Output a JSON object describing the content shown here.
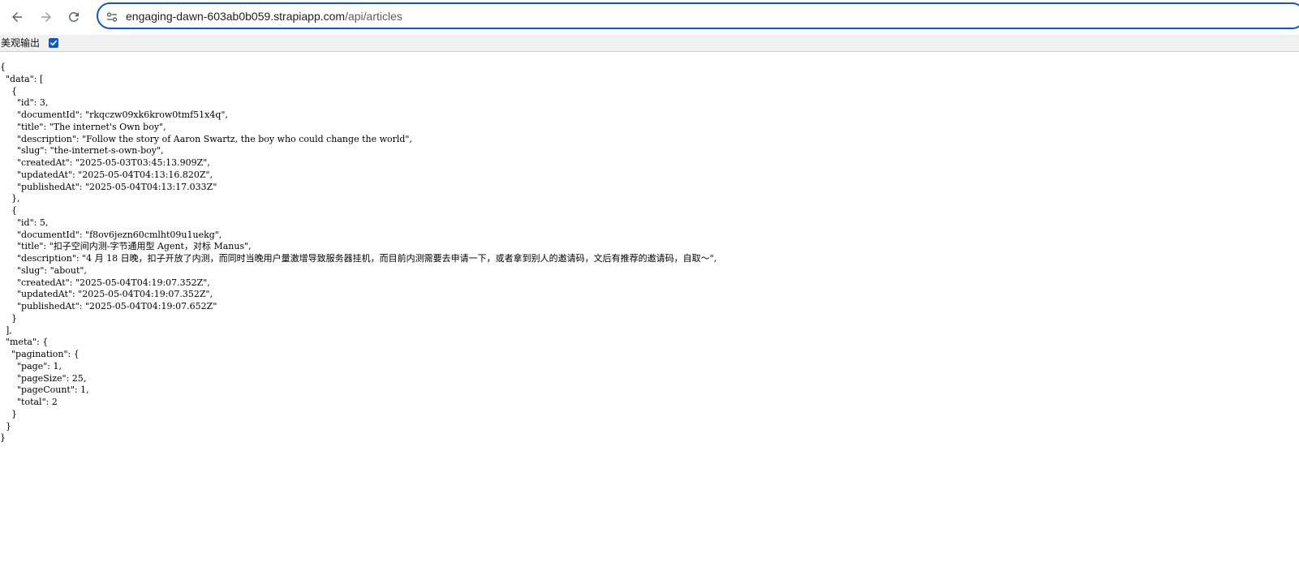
{
  "browser": {
    "url_host": "engaging-dawn-603ab0b059.strapiapp.com",
    "url_path": "/api/articles",
    "back_icon": "arrow-left-icon",
    "forward_icon": "arrow-right-icon",
    "reload_icon": "reload-icon",
    "site_info_icon": "tune-icon"
  },
  "pretty_print": {
    "label": "美观输出",
    "checked": true
  },
  "json_lines": [
    "{",
    "  \"data\": [",
    "    {",
    "      \"id\": 3,",
    "      \"documentId\": \"rkqczw09xk6krow0tmf51x4q\",",
    "      \"title\": \"The internet's Own boy\",",
    "      \"description\": \"Follow the story of Aaron Swartz, the boy who could change the world\",",
    "      \"slug\": \"the-internet-s-own-boy\",",
    "      \"createdAt\": \"2025-05-03T03:45:13.909Z\",",
    "      \"updatedAt\": \"2025-05-04T04:13:16.820Z\",",
    "      \"publishedAt\": \"2025-05-04T04:13:17.033Z\"",
    "    },",
    "    {",
    "      \"id\": 5,",
    "      \"documentId\": \"f8ov6jezn60cmlht09u1uekg\",",
    "      \"title\": \"扣子空间内测-字节通用型 Agent，对标 Manus\",",
    "      \"description\": \"4 月 18 日晚，扣子开放了内测，而同时当晚用户量激增导致服务器挂机，而目前内测需要去申请一下，或者拿到别人的邀请码，文后有推荐的邀请码，自取～\",",
    "      \"slug\": \"about\",",
    "      \"createdAt\": \"2025-05-04T04:19:07.352Z\",",
    "      \"updatedAt\": \"2025-05-04T04:19:07.352Z\",",
    "      \"publishedAt\": \"2025-05-04T04:19:07.652Z\"",
    "    }",
    "  ],",
    "  \"meta\": {",
    "    \"pagination\": {",
    "      \"page\": 1,",
    "      \"pageSize\": 25,",
    "      \"pageCount\": 1,",
    "      \"total\": 2",
    "    }",
    "  }",
    "}"
  ],
  "colors": {
    "accent": "#0b57d0",
    "icon": "#5f6368"
  }
}
